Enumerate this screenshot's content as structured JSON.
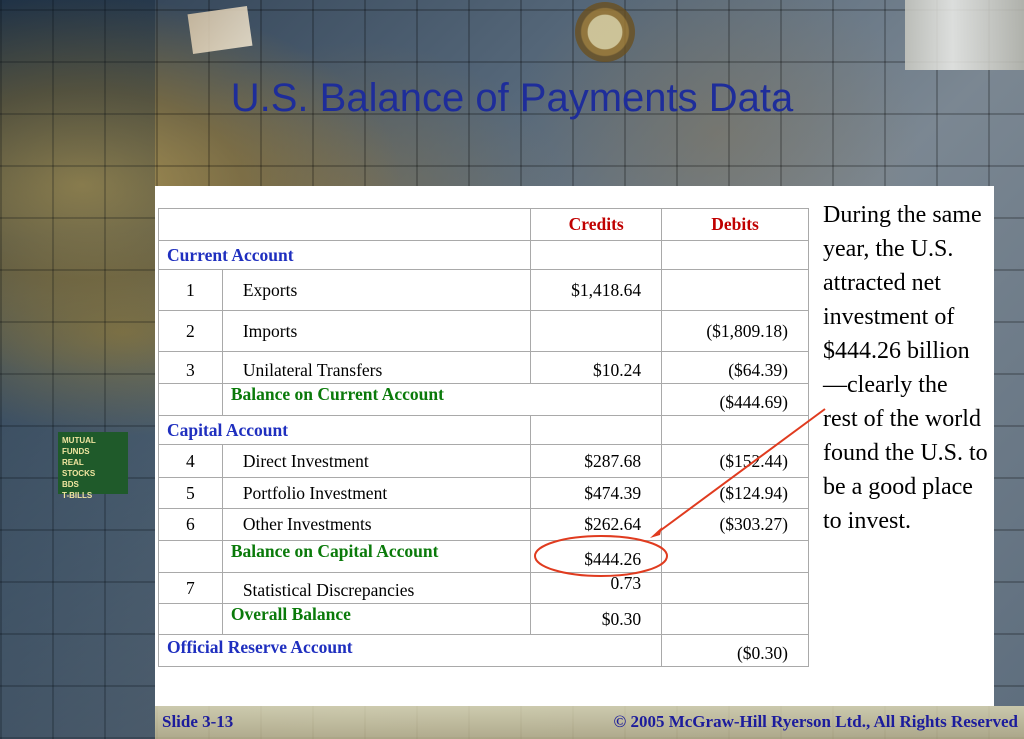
{
  "slide": {
    "title": "U.S. Balance of Payments Data",
    "footer_left": "Slide 3-13",
    "footer_right": "© 2005 McGraw-Hill Ryerson Ltd., All Rights Reserved",
    "background_image_text": [
      "MUTUAL FUNDS",
      "REAL",
      "STOCKS",
      "BDS",
      "T-BILLS"
    ]
  },
  "table": {
    "headers": {
      "credits": "Credits",
      "debits": "Debits"
    },
    "current_account": "Current Account",
    "rows_current": [
      {
        "num": "1",
        "label": "Exports",
        "credit": "$1,418.64",
        "debit": ""
      },
      {
        "num": "2",
        "label": "Imports",
        "credit": "",
        "debit": "($1,809.18)"
      },
      {
        "num": "3",
        "label": "Unilateral Transfers",
        "credit": "$10.24",
        "debit": "($64.39)"
      }
    ],
    "balance_current": {
      "label": "Balance on Current Account",
      "debit": "($444.69)"
    },
    "capital_account": "Capital Account",
    "rows_capital": [
      {
        "num": "4",
        "label": "Direct Investment",
        "credit": "$287.68",
        "debit": "($152.44)"
      },
      {
        "num": "5",
        "label": "Portfolio Investment",
        "credit": "$474.39",
        "debit": "($124.94)"
      },
      {
        "num": "6",
        "label": "Other Investments",
        "credit": "$262.64",
        "debit": "($303.27)"
      }
    ],
    "balance_capital": {
      "label": "Balance on Capital Account",
      "credit": "$444.26"
    },
    "statistical": {
      "num": "7",
      "label": "Statistical Discrepancies",
      "credit": "0.73"
    },
    "overall": {
      "label": "Overall Balance",
      "credit": "$0.30"
    },
    "official_reserve": {
      "label": "Official Reserve Account",
      "debit": "($0.30)"
    }
  },
  "note": "During the same year, the U.S. attracted net investment of $444.26 billion—clearly the rest of the world found the U.S. to be a good place to invest.",
  "colors": {
    "title": "#1e2d9a",
    "section_label": "#1f2fbf",
    "balance_label": "#0a7a0a",
    "header": "#c00000",
    "annotation": "#e03b1f"
  }
}
